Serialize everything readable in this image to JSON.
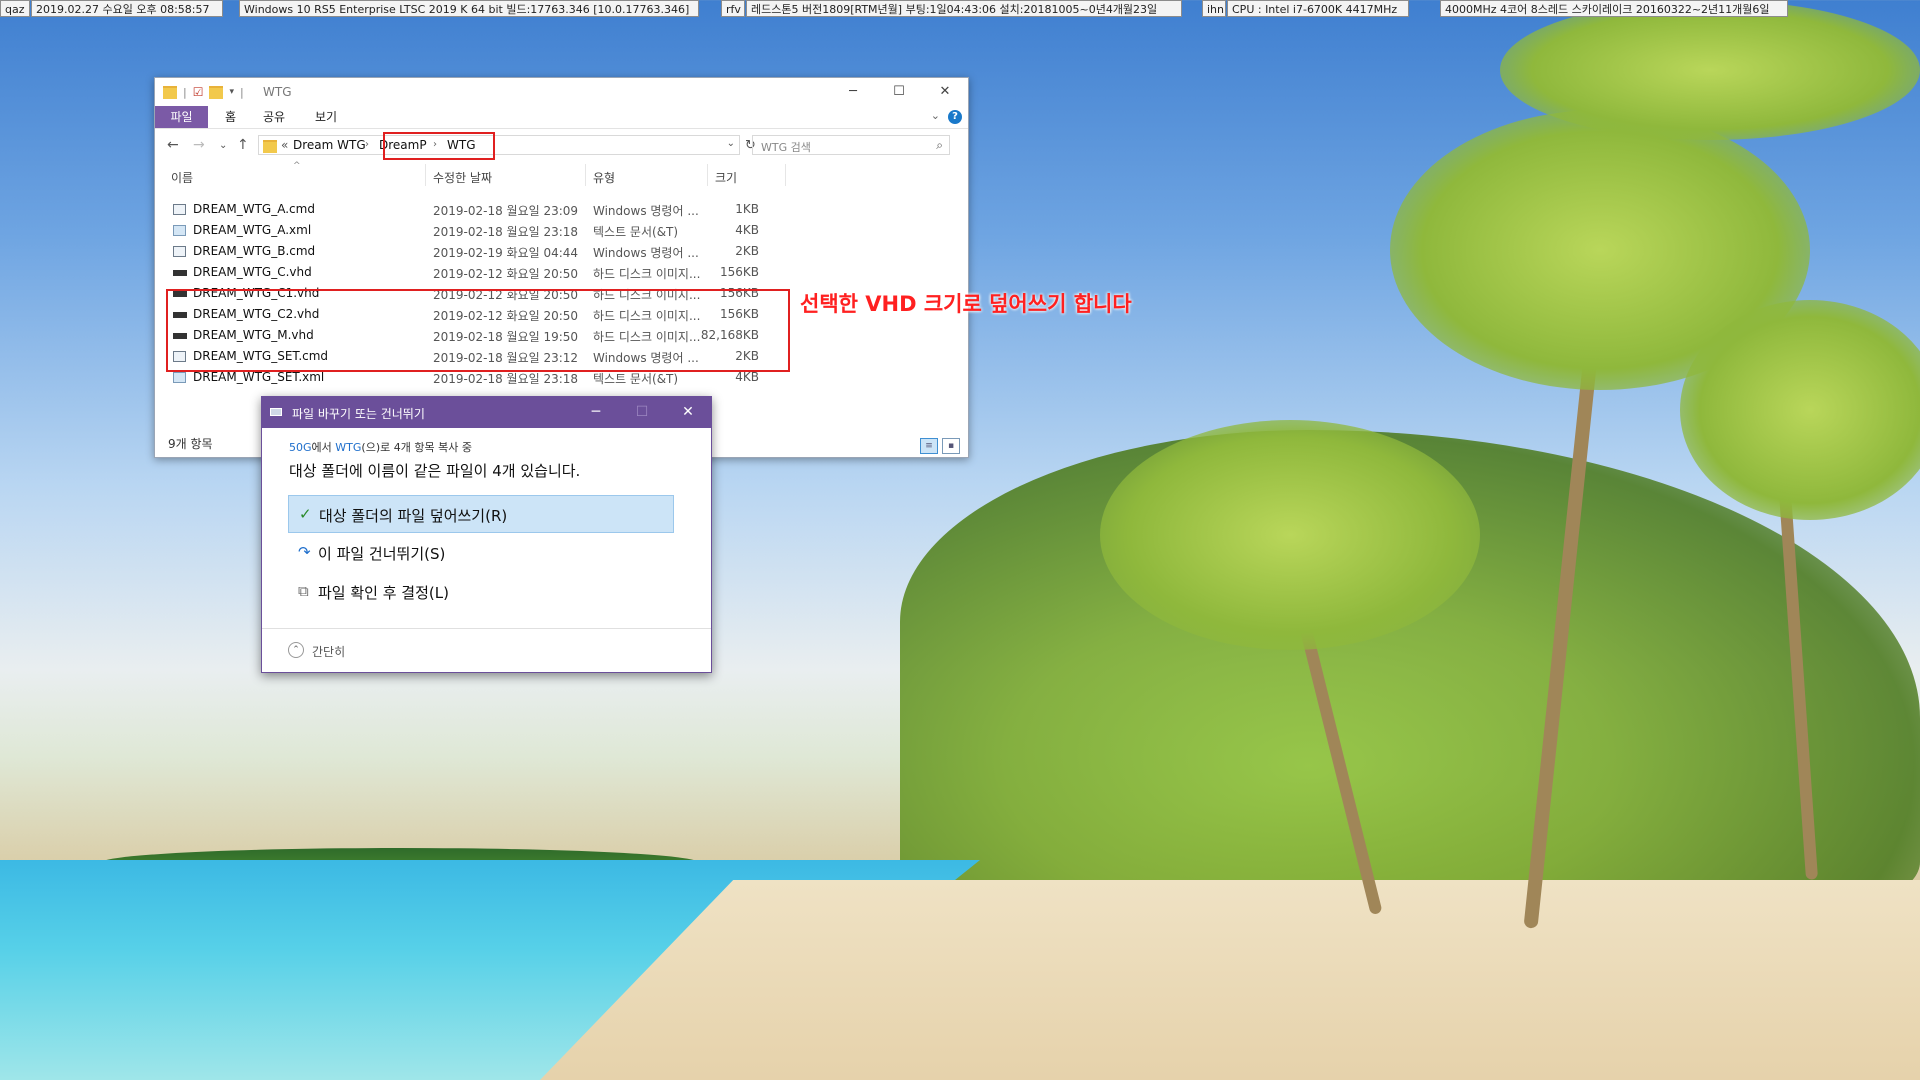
{
  "topbar": {
    "cells": [
      {
        "text": "qaz"
      },
      {
        "text": "2019.02.27 수요일 오후 08:58:57"
      },
      {
        "text": "Windows 10 RS5 Enterprise LTSC 2019 K 64 bit 빌드:17763.346 [10.0.17763.346]"
      },
      {
        "text": "rfv"
      },
      {
        "text": "레드스톤5 버전1809[RTM년월] 부팅:1일04:43:06 설치:20181005~0년4개월23일"
      },
      {
        "text": "ihn"
      },
      {
        "text": "CPU : Intel i7-6700K 4417MHz"
      },
      {
        "text": "4000MHz 4코어 8스레드 스카이레이크 20160322~2년11개월6일"
      }
    ]
  },
  "explorer": {
    "title": "WTG",
    "window_controls": {
      "minimize": "─",
      "maximize": "☐",
      "close": "✕"
    },
    "ribbon_tabs": [
      "파일",
      "홈",
      "공유",
      "보기"
    ],
    "address": {
      "prefix": "«",
      "crumbs": [
        "Dream WTG",
        "DreamP",
        "WTG"
      ],
      "separator": "›"
    },
    "search_placeholder": "WTG 검색",
    "columns": {
      "name": "이름",
      "date": "수정한 날짜",
      "type": "유형",
      "size": "크기"
    },
    "files": [
      {
        "name": "DREAM_WTG_A.cmd",
        "date": "2019-02-18 월요일 23:09",
        "type": "Windows 명령어 ...",
        "size": "1KB",
        "icon": "cmd-file-icon"
      },
      {
        "name": "DREAM_WTG_A.xml",
        "date": "2019-02-18 월요일 23:18",
        "type": "텍스트 문서(&T)",
        "size": "4KB",
        "icon": "xml-file-icon"
      },
      {
        "name": "DREAM_WTG_B.cmd",
        "date": "2019-02-19 화요일 04:44",
        "type": "Windows 명령어 ...",
        "size": "2KB",
        "icon": "cmd-file-icon"
      },
      {
        "name": "DREAM_WTG_C.vhd",
        "date": "2019-02-12 화요일 20:50",
        "type": "하드 디스크 이미지...",
        "size": "156KB",
        "icon": "vhd-file-icon"
      },
      {
        "name": "DREAM_WTG_C1.vhd",
        "date": "2019-02-12 화요일 20:50",
        "type": "하드 디스크 이미지...",
        "size": "156KB",
        "icon": "vhd-file-icon"
      },
      {
        "name": "DREAM_WTG_C2.vhd",
        "date": "2019-02-12 화요일 20:50",
        "type": "하드 디스크 이미지...",
        "size": "156KB",
        "icon": "vhd-file-icon"
      },
      {
        "name": "DREAM_WTG_M.vhd",
        "date": "2019-02-18 월요일 19:50",
        "type": "하드 디스크 이미지...",
        "size": "82,168KB",
        "icon": "vhd-file-icon"
      },
      {
        "name": "DREAM_WTG_SET.cmd",
        "date": "2019-02-18 월요일 23:12",
        "type": "Windows 명령어 ...",
        "size": "2KB",
        "icon": "cmd-file-icon"
      },
      {
        "name": "DREAM_WTG_SET.xml",
        "date": "2019-02-18 월요일 23:18",
        "type": "텍스트 문서(&T)",
        "size": "4KB",
        "icon": "xml-file-icon"
      }
    ],
    "status": "9개 항목"
  },
  "annotation": "선택한 VHD 크기로 덮어쓰기 합니다",
  "dialog": {
    "title": "파일 바꾸기 또는 건너뛰기",
    "controls": {
      "minimize": "─",
      "maximize": "☐",
      "close": "✕"
    },
    "subtitle": {
      "source": "50G",
      "text1": "에서 ",
      "dest": "WTG",
      "text2": "(으)로 4개 항목 복사 중"
    },
    "message": "대상 폴더에 이름이 같은 파일이 4개 있습니다.",
    "options": [
      {
        "label": "대상 폴더의 파일 덮어쓰기(R)",
        "icon": "checkmark-icon",
        "selected": true
      },
      {
        "label": "이 파일 건너뛰기(S)",
        "icon": "skip-arrow-icon",
        "selected": false
      },
      {
        "label": "파일 확인 후 결정(L)",
        "icon": "compare-files-icon",
        "selected": false
      }
    ],
    "collapse_label": "간단히"
  },
  "colors": {
    "dialog_title_bg": "#6b4f9a",
    "ribbon_file_tab": "#7b5aa6",
    "annotation_red": "#ff2020",
    "selected_option_bg": "#cce4f7",
    "link_blue": "#1f6fcc"
  }
}
